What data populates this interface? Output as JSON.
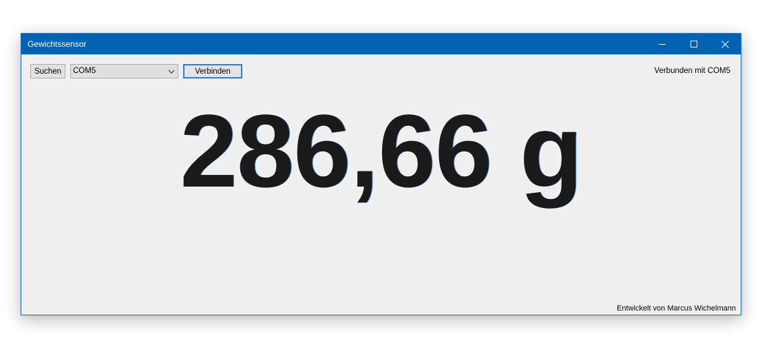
{
  "window": {
    "title": "Gewichtssensor"
  },
  "titlebar_icons": {
    "minimize": "minimize-icon",
    "maximize": "maximize-icon",
    "close": "close-icon"
  },
  "toolbar": {
    "search_label": "Suchen",
    "port_selected": "COM5",
    "connect_label": "Verbinden"
  },
  "status": {
    "text": "Verbunden mit COM5"
  },
  "reading": {
    "value_text": "286,66 g"
  },
  "footer": {
    "credit": "Entwickelt von Marcus Wichelmann"
  },
  "colors": {
    "titlebar": "#0063b1",
    "client_bg": "#f0f0f0",
    "focus_border": "#2f7ed8"
  }
}
